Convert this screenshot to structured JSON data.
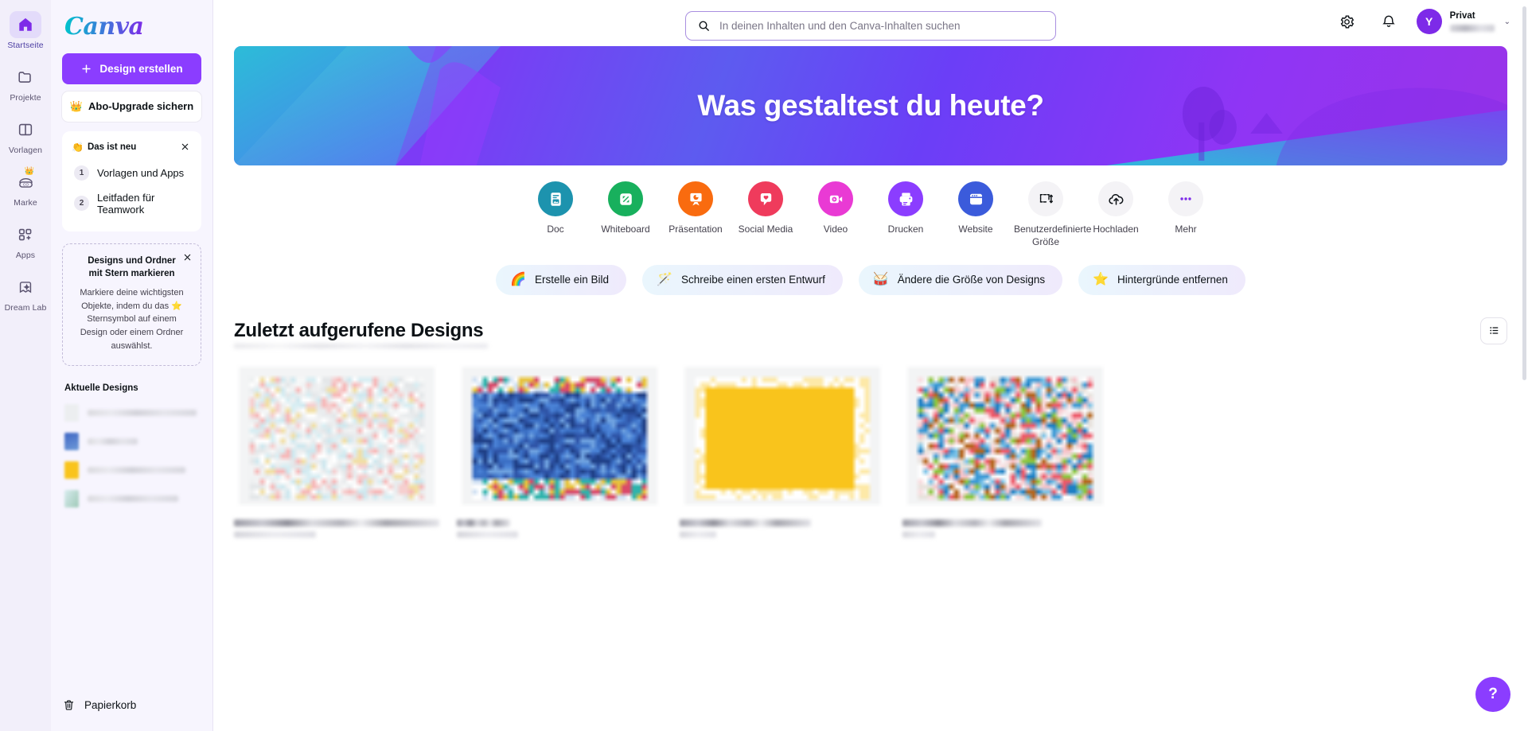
{
  "app": {
    "brand": "Canva"
  },
  "rail": {
    "items": [
      {
        "name": "startseite",
        "label": "Startseite",
        "icon": "home-icon",
        "active": true,
        "crown": false
      },
      {
        "name": "projekte",
        "label": "Projekte",
        "icon": "folder-icon",
        "active": false,
        "crown": false
      },
      {
        "name": "vorlagen",
        "label": "Vorlagen",
        "icon": "templates-icon",
        "active": false,
        "crown": false
      },
      {
        "name": "marke",
        "label": "Marke",
        "icon": "brand-icon",
        "active": false,
        "crown": true
      },
      {
        "name": "apps",
        "label": "Apps",
        "icon": "apps-icon",
        "active": false,
        "crown": false
      },
      {
        "name": "dream-lab",
        "label": "Dream Lab",
        "icon": "dream-lab-icon",
        "active": false,
        "crown": false
      }
    ]
  },
  "sidebar": {
    "create_button": "Design erstellen",
    "upgrade_button": "Abo-Upgrade sichern",
    "upgrade_icon": "crown-icon",
    "news": {
      "emoji": "👏",
      "title": "Das ist neu",
      "close_icon": "close-icon",
      "items": [
        {
          "num": "1",
          "label": "Vorlagen und Apps"
        },
        {
          "num": "2",
          "label": "Leitfaden für Teamwork"
        }
      ]
    },
    "tip": {
      "close_icon": "close-icon",
      "title": "Designs und Ordner mit Stern markieren",
      "body_before": "Markiere deine wichtigsten Objekte, indem du das ",
      "body_star": "⭐",
      "body_after": " Sternsymbol auf einem Design oder einem Ordner auswählst."
    },
    "recent_title": "Aktuelle Designs",
    "recent_items": [
      {
        "thumb_color": "#eceef0"
      },
      {
        "thumb_color": "#4a7fd0"
      },
      {
        "thumb_color": "#f9c41c"
      },
      {
        "thumb_color": "#cfe0e3"
      }
    ],
    "trash_label": "Papierkorb",
    "trash_icon": "trash-icon"
  },
  "header": {
    "search_placeholder": "In deinen Inhalten und den Canva-Inhalten suchen",
    "search_value": "",
    "search_icon": "search-icon",
    "settings_icon": "gear-icon",
    "notifications_icon": "bell-icon",
    "avatar_initial": "Y",
    "account_name": "Privat",
    "account_chevron": "⌄"
  },
  "hero": {
    "headline": "Was gestaltest du heute?"
  },
  "categories": [
    {
      "label": "Doc",
      "icon": "doc-icon",
      "color": "#1d93ae",
      "fg": "#ffffff"
    },
    {
      "label": "Whiteboard",
      "icon": "whiteboard-icon",
      "color": "#18b05d",
      "fg": "#ffffff"
    },
    {
      "label": "Präsentation",
      "icon": "presentation-icon",
      "color": "#f96b0f",
      "fg": "#ffffff"
    },
    {
      "label": "Social Media",
      "icon": "social-media-icon",
      "color": "#ef3b5c",
      "fg": "#ffffff"
    },
    {
      "label": "Video",
      "icon": "video-icon",
      "color": "#e93ad4",
      "fg": "#ffffff"
    },
    {
      "label": "Drucken",
      "icon": "print-icon",
      "color": "#8b3dff",
      "fg": "#ffffff"
    },
    {
      "label": "Website",
      "icon": "website-icon",
      "color": "#3b5bdb",
      "fg": "#ffffff"
    },
    {
      "label": "Benutzerdefinierte Größe",
      "icon": "custom-size-icon",
      "color": "#f4f3f6",
      "fg": "#0d1216"
    },
    {
      "label": "Hochladen",
      "icon": "upload-icon",
      "color": "#f4f3f6",
      "fg": "#0d1216"
    },
    {
      "label": "Mehr",
      "icon": "more-icon",
      "color": "#f4f3f6",
      "fg": "#7d2ae8"
    }
  ],
  "chips": [
    {
      "emoji": "🌈",
      "label": "Erstelle ein Bild"
    },
    {
      "emoji": "🪄",
      "label": "Schreibe einen ersten Entwurf"
    },
    {
      "emoji": "🥁",
      "label": "Ändere die Größe von Designs"
    },
    {
      "emoji": "⭐",
      "label": "Hintergründe entfernen"
    }
  ],
  "recent": {
    "title": "Zuletzt aufgerufene Designs",
    "view_toggle_icon": "list-view-icon",
    "cards": [
      {
        "name": "design-card-1",
        "palette": "pastel"
      },
      {
        "name": "design-card-2",
        "palette": "blue"
      },
      {
        "name": "design-card-3",
        "palette": "yellow"
      },
      {
        "name": "design-card-4",
        "palette": "pink"
      }
    ]
  },
  "help": {
    "label": "?"
  }
}
